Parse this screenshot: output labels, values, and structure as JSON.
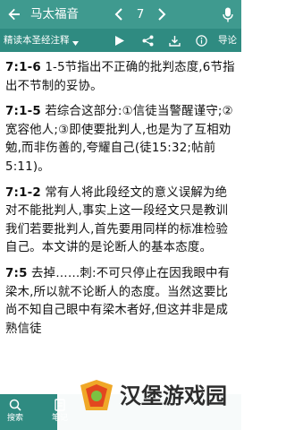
{
  "header": {
    "book_title": "马太福音",
    "chapter": "7",
    "back_icon": "arrow-left-icon",
    "prev_icon": "chevron-left-icon",
    "next_icon": "chevron-right-icon",
    "mic_icon": "microphone-icon"
  },
  "subheader": {
    "commentary_selector": "精读本圣经注释",
    "guide_label": "导论"
  },
  "paragraphs": [
    {
      "ref": "7:1-6",
      "text": " 1-5节指出不正确的批判态度,6节指出不节制的妥协。"
    },
    {
      "ref": "7:1-5",
      "text": " 若综合这部分:①信徒当警醒谨守;②宽容他人;③即使要批判人,也是为了互相劝勉,而非伤善的,夸耀自己(徒15:32;帖前5:11)。"
    },
    {
      "ref": "7:1-2",
      "text": " 常有人将此段经文的意义误解为绝对不能批判人,事实上这一段经文只是教训我们若要批判人,首先要用同样的标准检验自己。本文讲的是论断人的基本态度。"
    },
    {
      "ref": "7:5",
      "text": " 去掉……刺:不可只停止在因我眼中有梁木,所以就不论断人的态度。当然这要比尚不知自己眼中有梁木者好,但这并非是成熟信徒"
    }
  ],
  "bottom_tabs": [
    {
      "label": "搜索",
      "icon": "search-icon"
    },
    {
      "label": "笔记",
      "icon": "note-icon"
    }
  ],
  "watermark": {
    "text": "汉堡游戏园",
    "icon": "watermark-logo-icon"
  },
  "colors": {
    "topbar": "#3f9a8f",
    "subbar": "#2f8b81",
    "highlight": "#c62828"
  }
}
